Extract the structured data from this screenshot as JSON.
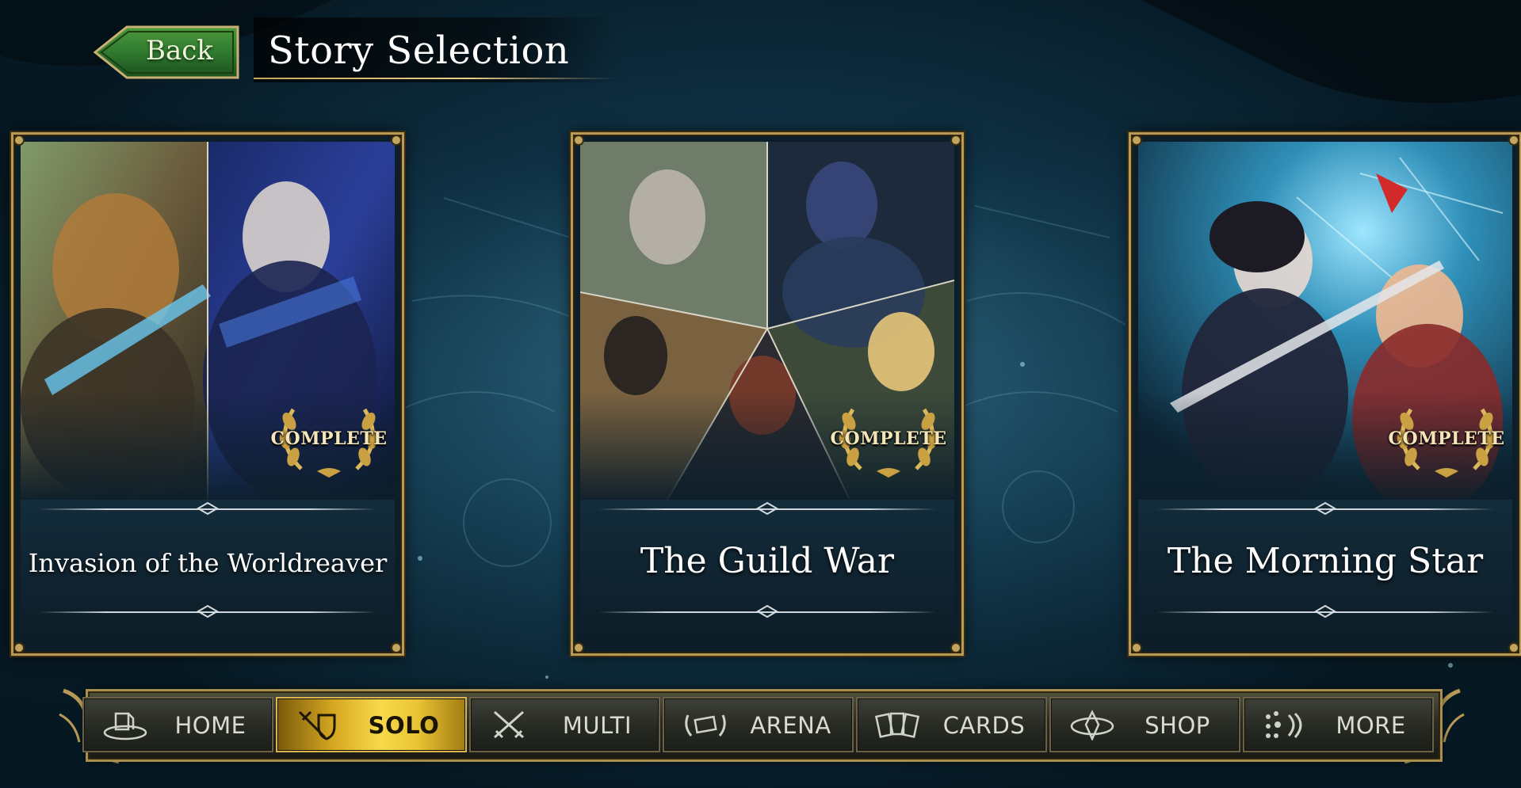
{
  "header": {
    "back_label": "Back",
    "title": "Story Selection"
  },
  "stories": [
    {
      "title": "Invasion of the Worldreaver",
      "badge": "COMPLETE",
      "status": "complete"
    },
    {
      "title": "The Guild War",
      "badge": "COMPLETE",
      "status": "complete"
    },
    {
      "title": "The Morning Star",
      "badge": "COMPLETE",
      "status": "complete"
    }
  ],
  "nav": {
    "selected": "SOLO",
    "items": [
      {
        "label": "HOME",
        "icon": "home-icon"
      },
      {
        "label": "SOLO",
        "icon": "sword-shield-icon"
      },
      {
        "label": "MULTI",
        "icon": "crossed-swords-icon"
      },
      {
        "label": "ARENA",
        "icon": "laurel-ticket-icon"
      },
      {
        "label": "CARDS",
        "icon": "cards-icon"
      },
      {
        "label": "SHOP",
        "icon": "crystal-icon"
      },
      {
        "label": "MORE",
        "icon": "more-dots-icon"
      }
    ]
  },
  "colors": {
    "accent_gold": "#c7a65a",
    "back_button_green": "#2f7a2f",
    "active_tab_gold": "#f7da4a",
    "background_teal": "#1b4a5e"
  }
}
